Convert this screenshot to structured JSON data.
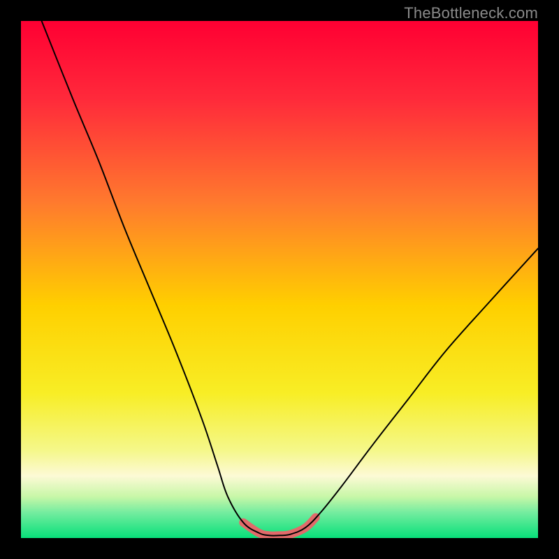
{
  "watermark": "TheBottleneck.com",
  "chart_data": {
    "type": "line",
    "title": "",
    "xlabel": "",
    "ylabel": "",
    "xlim": [
      0,
      100
    ],
    "ylim": [
      0,
      100
    ],
    "grid": false,
    "legend": false,
    "series": [
      {
        "name": "bottleneck-curve",
        "x": [
          4,
          10,
          15,
          20,
          25,
          30,
          35,
          38,
          40,
          43,
          46,
          48,
          50,
          52,
          55,
          58,
          62,
          68,
          75,
          82,
          90,
          100
        ],
        "y": [
          100,
          85,
          73,
          60,
          48,
          36,
          23,
          14,
          8,
          3,
          1,
          0.5,
          0.5,
          0.7,
          2,
          5,
          10,
          18,
          27,
          36,
          45,
          56
        ]
      },
      {
        "name": "optimal-band",
        "x": [
          43,
          46,
          48,
          50,
          52,
          55,
          57
        ],
        "y": [
          3,
          1,
          0.5,
          0.5,
          0.7,
          2,
          4
        ]
      }
    ],
    "background_gradient": {
      "stops": [
        {
          "pos": 0.0,
          "color": "#ff0033"
        },
        {
          "pos": 0.15,
          "color": "#ff2a3b"
        },
        {
          "pos": 0.35,
          "color": "#ff7a2e"
        },
        {
          "pos": 0.55,
          "color": "#ffd000"
        },
        {
          "pos": 0.72,
          "color": "#f8ee26"
        },
        {
          "pos": 0.83,
          "color": "#f5f88a"
        },
        {
          "pos": 0.88,
          "color": "#fdfad6"
        },
        {
          "pos": 0.92,
          "color": "#c8f7a8"
        },
        {
          "pos": 0.95,
          "color": "#76eda0"
        },
        {
          "pos": 1.0,
          "color": "#08e07a"
        }
      ]
    },
    "colors": {
      "curve": "#000000",
      "optimal_band": "#e26a6a"
    }
  }
}
